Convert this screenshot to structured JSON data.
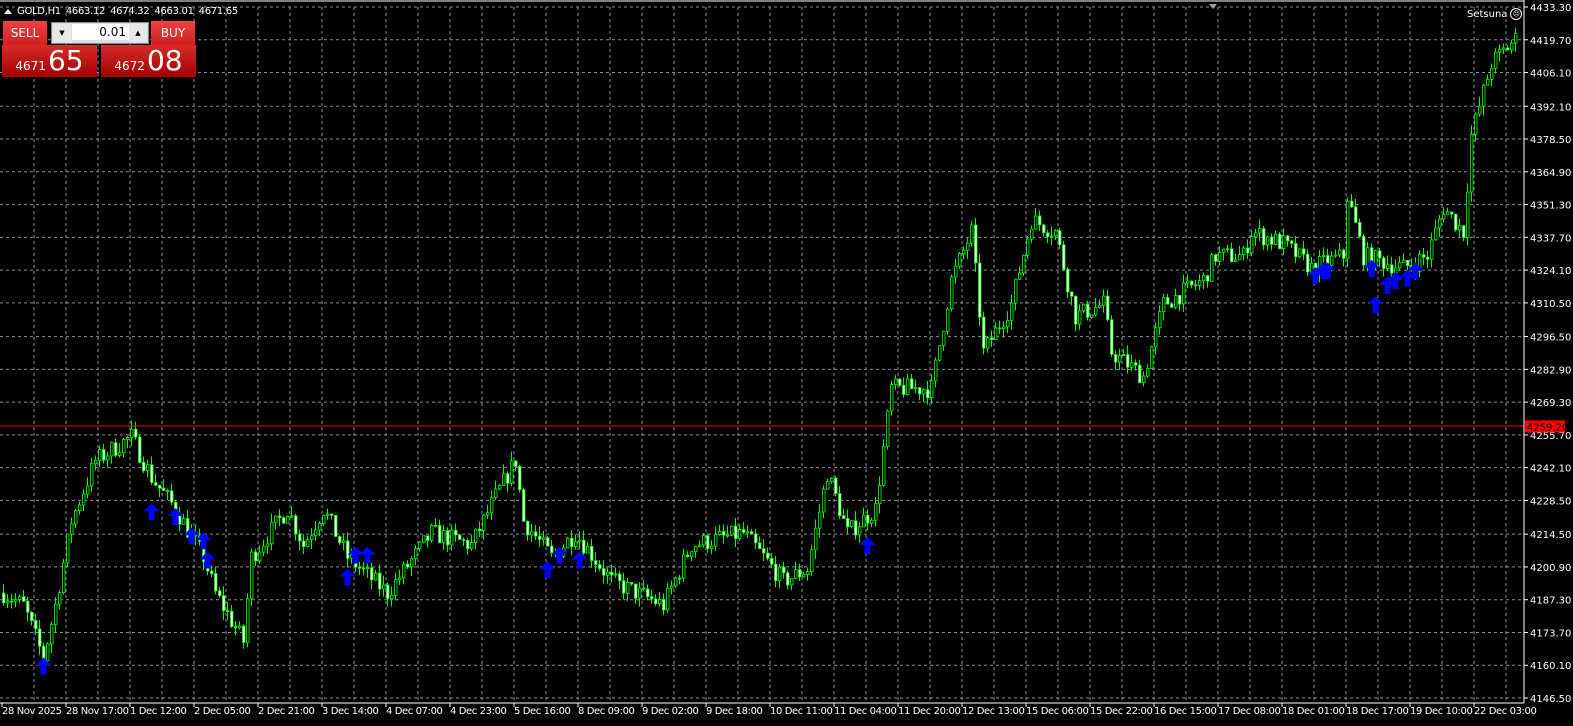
{
  "header": {
    "symbol": "GOLD,H1",
    "open": "4663.12",
    "high": "4674.32",
    "low": "4663.01",
    "close": "4671.65"
  },
  "trade_panel": {
    "sell_label": "SELL",
    "buy_label": "BUY",
    "lot": "0.01",
    "sell_price_prefix": "4671",
    "sell_price_big": "65",
    "buy_price_prefix": "4672",
    "buy_price_big": "08"
  },
  "account": {
    "name": "Setsuna",
    "icon": "frown-face-icon"
  },
  "colors": {
    "background": "#000000",
    "candle": "#00ff00",
    "grid": "#8090a0",
    "bid_line": "#ff0000",
    "arrow": "#0000ff"
  },
  "chart_data": {
    "type": "candlestick",
    "price_labels": [
      "4433.30",
      "4419.70",
      "4406.10",
      "4392.10",
      "4378.50",
      "4364.90",
      "4351.30",
      "4337.70",
      "4324.10",
      "4310.50",
      "4296.50",
      "4282.90",
      "4269.30",
      "4255.70",
      "4242.10",
      "4228.50",
      "4214.50",
      "4200.90",
      "4187.30",
      "4173.70",
      "4160.10",
      "4146.50"
    ],
    "ylim": [
      4146.5,
      4433.3
    ],
    "time_labels": [
      "28 Nov 2025",
      "28 Nov 17:00",
      "1 Dec 12:00",
      "2 Dec 05:00",
      "2 Dec 21:00",
      "3 Dec 14:00",
      "4 Dec 07:00",
      "4 Dec 23:00",
      "5 Dec 16:00",
      "8 Dec 09:00",
      "9 Dec 02:00",
      "9 Dec 18:00",
      "10 Dec 11:00",
      "11 Dec 04:00",
      "11 Dec 20:00",
      "12 Dec 13:00",
      "15 Dec 06:00",
      "15 Dec 22:00",
      "16 Dec 15:00",
      "17 Dec 08:00",
      "18 Dec 01:00",
      "18 Dec 17:00",
      "19 Dec 10:00",
      "22 Dec 03:00"
    ],
    "bars_per_label": 16,
    "bid_price": "4259.20",
    "close_path": [
      [
        0,
        4190
      ],
      [
        5,
        4185
      ],
      [
        10,
        4163
      ],
      [
        13,
        4185
      ],
      [
        17,
        4220
      ],
      [
        23,
        4245
      ],
      [
        32,
        4255
      ],
      [
        37,
        4238
      ],
      [
        43,
        4225
      ],
      [
        50,
        4205
      ],
      [
        53,
        4190
      ],
      [
        60,
        4170
      ],
      [
        62,
        4205
      ],
      [
        71,
        4225
      ],
      [
        75,
        4210
      ],
      [
        80,
        4225
      ],
      [
        86,
        4205
      ],
      [
        96,
        4190
      ],
      [
        107,
        4215
      ],
      [
        117,
        4210
      ],
      [
        123,
        4230
      ],
      [
        128,
        4245
      ],
      [
        130,
        4220
      ],
      [
        137,
        4205
      ],
      [
        143,
        4215
      ],
      [
        152,
        4195
      ],
      [
        165,
        4185
      ],
      [
        172,
        4210
      ],
      [
        185,
        4215
      ],
      [
        195,
        4195
      ],
      [
        201,
        4200
      ],
      [
        206,
        4240
      ],
      [
        211,
        4215
      ],
      [
        218,
        4225
      ],
      [
        222,
        4275
      ],
      [
        232,
        4275
      ],
      [
        237,
        4320
      ],
      [
        242,
        4340
      ],
      [
        245,
        4290
      ],
      [
        252,
        4310
      ],
      [
        257,
        4345
      ],
      [
        263,
        4340
      ],
      [
        268,
        4305
      ],
      [
        275,
        4310
      ],
      [
        277,
        4290
      ],
      [
        285,
        4280
      ],
      [
        290,
        4310
      ],
      [
        300,
        4320
      ],
      [
        303,
        4330
      ],
      [
        310,
        4330
      ],
      [
        312,
        4340
      ],
      [
        320,
        4335
      ],
      [
        327,
        4325
      ],
      [
        335,
        4330
      ],
      [
        336,
        4355
      ],
      [
        340,
        4330
      ],
      [
        350,
        4325
      ],
      [
        356,
        4330
      ],
      [
        360,
        4350
      ],
      [
        365,
        4340
      ],
      [
        367,
        4380
      ],
      [
        372,
        4410
      ],
      [
        378,
        4420
      ]
    ],
    "signal_arrows": [
      [
        10,
        4160
      ],
      [
        37,
        4224
      ],
      [
        43,
        4222
      ],
      [
        47,
        4214
      ],
      [
        50,
        4212
      ],
      [
        51,
        4204
      ],
      [
        86,
        4197
      ],
      [
        88,
        4206
      ],
      [
        91,
        4206
      ],
      [
        136,
        4200
      ],
      [
        139,
        4206
      ],
      [
        144,
        4204
      ],
      [
        216,
        4210
      ],
      [
        328,
        4322
      ],
      [
        330,
        4324
      ],
      [
        331,
        4324
      ],
      [
        342,
        4325
      ],
      [
        343,
        4310
      ],
      [
        346,
        4318
      ],
      [
        348,
        4320
      ],
      [
        351,
        4321
      ],
      [
        353,
        4324
      ]
    ]
  }
}
